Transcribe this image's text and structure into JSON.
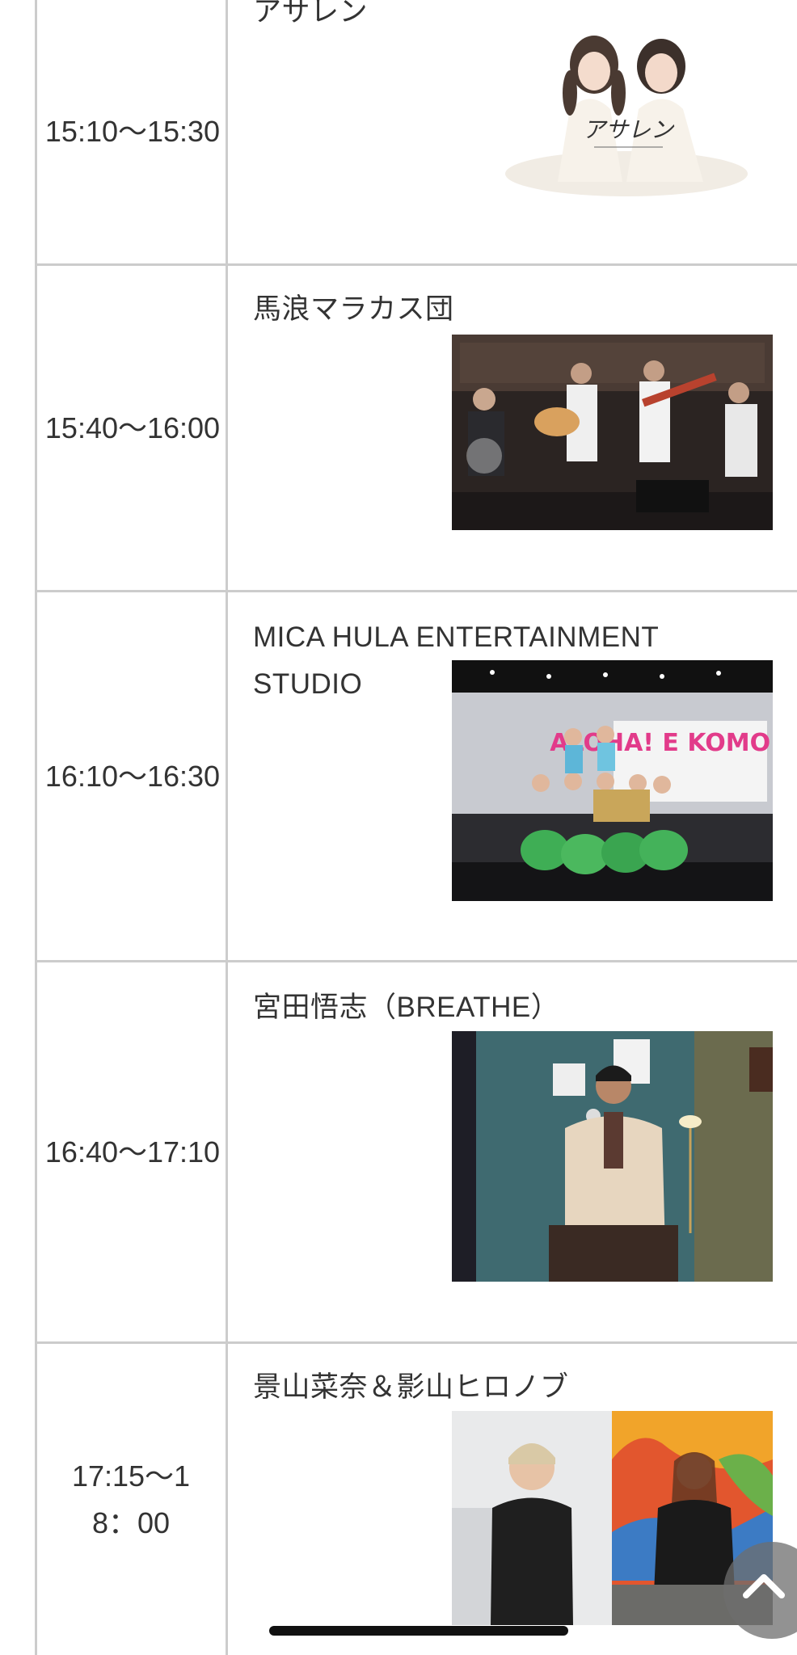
{
  "schedule": [
    {
      "time": "15:10～15:30",
      "performer": "アサレン",
      "image_icon": "duo-photo-icon",
      "logo_text": "アサレン"
    },
    {
      "time": "15:40～16:00",
      "performer": "馬浪マラカス団",
      "image_icon": "band-photo-icon"
    },
    {
      "time": "16:10～16:30",
      "performer": "MICA HULA ENTERTAINMENT STUDIO",
      "image_icon": "hula-group-photo-icon",
      "banner_text": "ALOHA! E KOMO MAI"
    },
    {
      "time": "16:40～17:10",
      "performer": "宮田悟志（BREATHE）",
      "image_icon": "portrait-photo-icon"
    },
    {
      "time": "17:15～18：00",
      "performer": "景山菜奈＆影山ヒロノブ",
      "image_icon": "two-portraits-photo-icon"
    }
  ],
  "colors": {
    "border": "#cccccc",
    "text": "#333333",
    "background": "#ffffff"
  },
  "controls": {
    "scroll_top_icon": "chevron-up-icon"
  }
}
